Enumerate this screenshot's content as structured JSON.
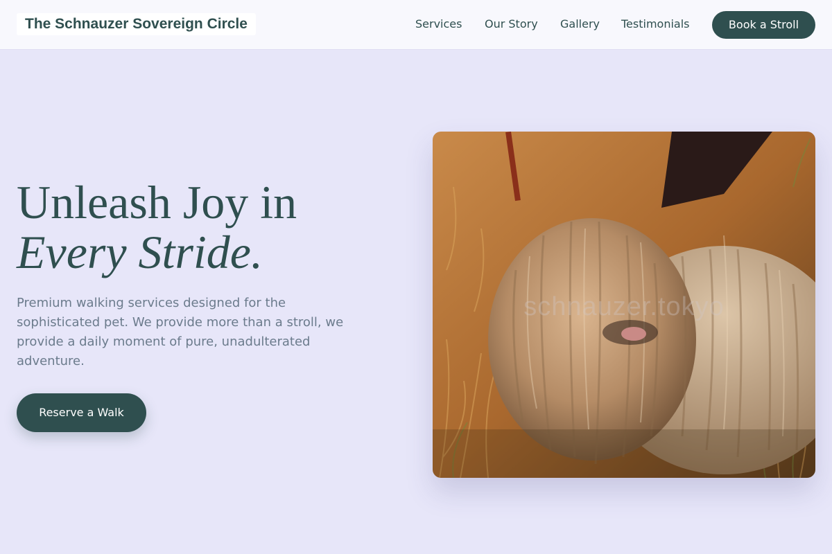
{
  "header": {
    "brand": "The Schnauzer Sovereign Circle",
    "nav": {
      "services": "Services",
      "our_story": "Our Story",
      "gallery": "Gallery",
      "testimonials": "Testimonials"
    },
    "book_label": "Book a Stroll"
  },
  "hero": {
    "headline_line1": "Unleash Joy in",
    "headline_line2": "Every Stride.",
    "subtitle": "Premium walking services designed for the sophisticated pet. We provide more than a stroll, we provide a daily moment of pure, unadulterated adventure.",
    "cta_label": "Reserve a Walk",
    "image_watermark": "schnauzer.tokyo"
  },
  "colors": {
    "background": "#e7e6f9",
    "accent": "#2f4f4f",
    "header_bg": "#f8f8fd",
    "muted_text": "#6b7b8c"
  }
}
